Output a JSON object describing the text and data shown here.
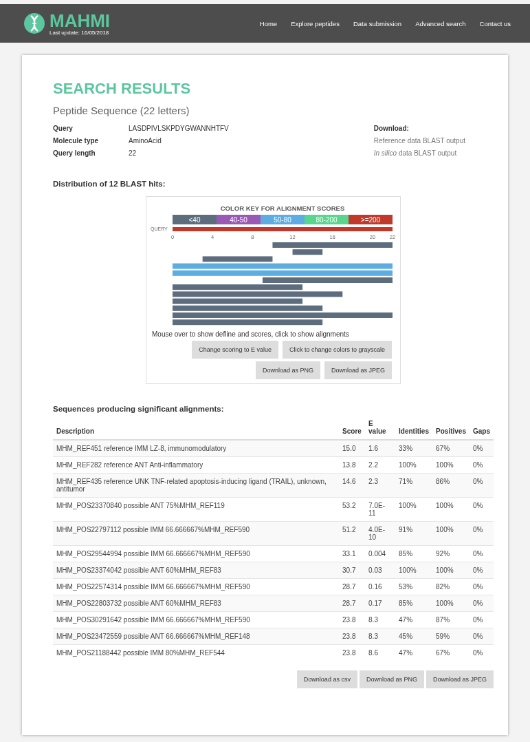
{
  "header": {
    "logo_text": "MAHMI",
    "last_update": "Last update: 16/05/2018",
    "nav": [
      "Home",
      "Explore peptides",
      "Data submission",
      "Advanced search",
      "Contact us"
    ]
  },
  "title": "SEARCH RESULTS",
  "subtitle": "Peptide Sequence (22 letters)",
  "details": [
    {
      "label": "Query",
      "value": "LASDPIVLSKPDYGWANNHTFV"
    },
    {
      "label": "Molecule type",
      "value": "AminoAcid"
    },
    {
      "label": "Query length",
      "value": "22"
    }
  ],
  "download": {
    "heading": "Download:",
    "links": [
      "Reference data BLAST output",
      "*In silico* data BLAST output"
    ]
  },
  "distribution": {
    "heading": "Distribution of 12 BLAST hits:",
    "color_key": {
      "title": "COLOR KEY FOR ALIGNMENT SCORES",
      "bands": [
        {
          "label": "<40",
          "color": "#5d6d7e"
        },
        {
          "label": "40-50",
          "color": "#9b59b6"
        },
        {
          "label": "50-80",
          "color": "#5dade2"
        },
        {
          "label": "80-200",
          "color": "#58d68d"
        },
        {
          "label": ">=200",
          "color": "#c0392b"
        }
      ]
    },
    "query_label": "QUERY",
    "axis_ticks": [
      "0",
      "4",
      "8",
      "12",
      "16",
      "20",
      "22"
    ],
    "caption": "Mouse over to show defline and scores, click to show alignments",
    "buttons": [
      [
        "Change scoring to E value",
        "Click to change colors to grayscale"
      ],
      [
        "Download as PNG",
        "Download as JPEG"
      ]
    ]
  },
  "alignments": {
    "heading": "Sequences producing significant alignments:",
    "columns": [
      "Description",
      "Score",
      "E value",
      "Identities",
      "Positives",
      "Gaps"
    ],
    "rows": [
      [
        "MHM_REF451 reference IMM LZ-8, immunomodulatory",
        "15.0",
        "1.6",
        "33%",
        "67%",
        "0%"
      ],
      [
        "MHM_REF282 reference ANT Anti-inflammatory",
        "13.8",
        "2.2",
        "100%",
        "100%",
        "0%"
      ],
      [
        "MHM_REF435 reference UNK TNF-related apoptosis-inducing ligand (TRAIL), unknown, antitumor",
        "14.6",
        "2.3",
        "71%",
        "86%",
        "0%"
      ],
      [
        "MHM_POS23370840 possible ANT 75%MHM_REF119",
        "53.2",
        "7.0E-11",
        "100%",
        "100%",
        "0%"
      ],
      [
        "MHM_POS22797112 possible IMM 66.666667%MHM_REF590",
        "51.2",
        "4.0E-10",
        "91%",
        "100%",
        "0%"
      ],
      [
        "MHM_POS29544994 possible IMM 66.666667%MHM_REF590",
        "33.1",
        "0.004",
        "85%",
        "92%",
        "0%"
      ],
      [
        "MHM_POS23374042 possible ANT 60%MHM_REF83",
        "30.7",
        "0.03",
        "100%",
        "100%",
        "0%"
      ],
      [
        "MHM_POS22574314 possible IMM 66.666667%MHM_REF590",
        "28.7",
        "0.16",
        "53%",
        "82%",
        "0%"
      ],
      [
        "MHM_POS22803732 possible ANT 60%MHM_REF83",
        "28.7",
        "0.17",
        "85%",
        "100%",
        "0%"
      ],
      [
        "MHM_POS30291642 possible IMM 66.666667%MHM_REF590",
        "23.8",
        "8.3",
        "47%",
        "87%",
        "0%"
      ],
      [
        "MHM_POS23472559 possible ANT 66.666667%MHM_REF148",
        "23.8",
        "8.3",
        "45%",
        "59%",
        "0%"
      ],
      [
        "MHM_POS21188442 possible IMM 80%MHM_REF544",
        "23.8",
        "8.6",
        "47%",
        "67%",
        "0%"
      ]
    ],
    "buttons": [
      "Download as csv",
      "Download as PNG",
      "Download as JPEG"
    ]
  }
}
